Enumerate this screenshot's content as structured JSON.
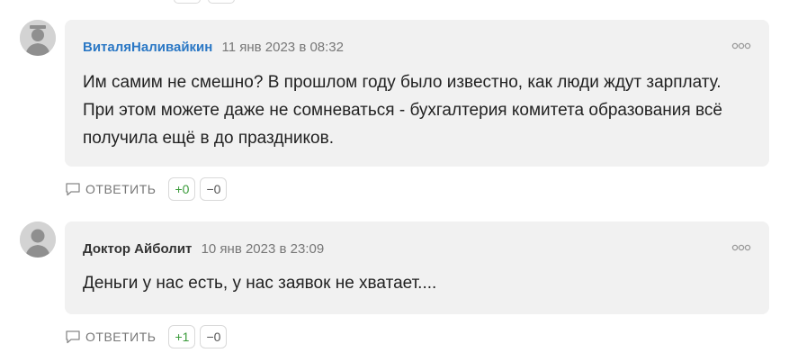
{
  "comments": [
    {
      "author": "ВиталяНаливайкин",
      "date": "11 янв 2023 в 08:32",
      "text": "Им самим не смешно? В прошлом году было известно, как люди ждут зарплату. При этом можете даже не сомневаться - бухгалтерия комитета образования всё получила ещё в до праздников.",
      "reply_label": "ОТВЕТИТЬ",
      "plus": "+0",
      "minus": "−0",
      "author_color": "#2b78c5"
    },
    {
      "author": "Доктор Айболит",
      "date": "10 янв 2023 в 23:09",
      "text": "Деньги у нас есть, у нас заявок не хватает....",
      "reply_label": "ОТВЕТИТЬ",
      "plus": "+1",
      "minus": "−0",
      "author_color": "#333333"
    }
  ],
  "icons": {
    "avatar": "user-silhouette-icon",
    "menu": "more-dots-icon",
    "reply": "speech-bubble-icon"
  },
  "colors": {
    "bubble_bg": "#f1f1f1",
    "plus_vote": "#3a9b3a",
    "date": "#777777"
  }
}
